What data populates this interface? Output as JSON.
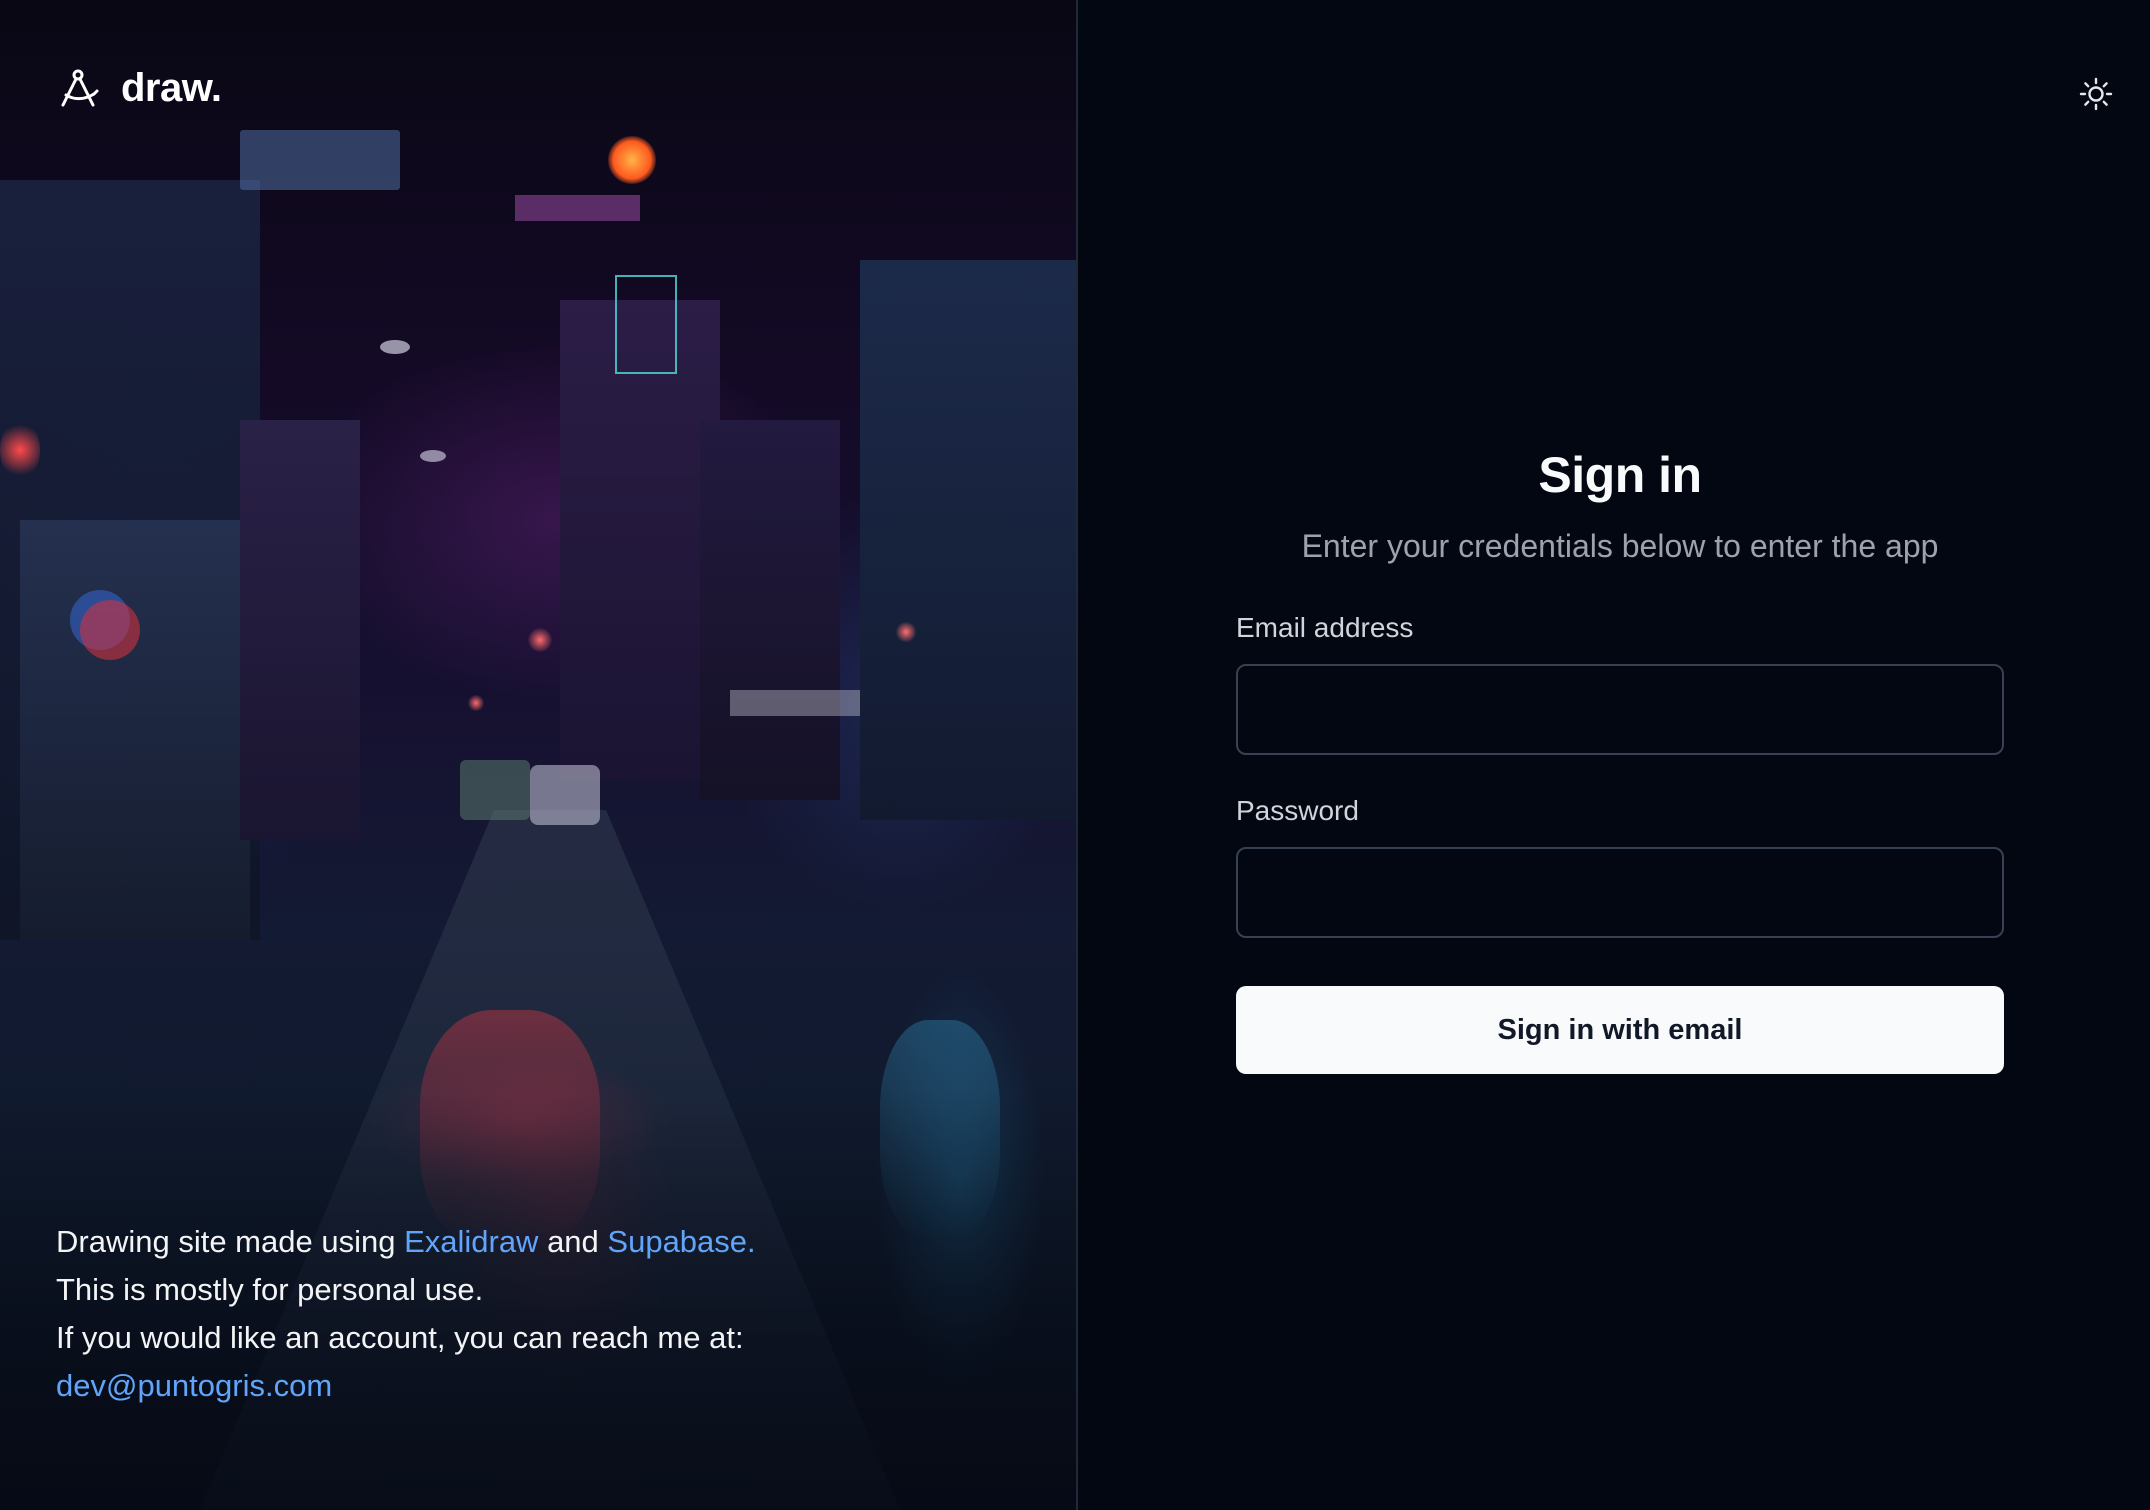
{
  "brand": {
    "logo_icon": "compass-drafting-icon",
    "name": "draw."
  },
  "theme_toggle": {
    "icon": "sun-icon"
  },
  "hero": {
    "line1_prefix": "Drawing site made using ",
    "link_exalidraw": "Exalidraw",
    "line1_middle": " and ",
    "link_supabase": "Supabase.",
    "line2": "This is mostly for personal use.",
    "line3": "If you would like an account, you can reach me at:",
    "email_link": "dev@puntogris.com"
  },
  "form": {
    "title": "Sign in",
    "subtitle": "Enter your credentials below to enter the app",
    "email_label": "Email address",
    "email_value": "",
    "password_label": "Password",
    "password_value": "",
    "submit_label": "Sign in with email"
  },
  "colors": {
    "background": "#030712",
    "link": "#60a5fa",
    "button_bg": "#f9fafb",
    "button_text": "#111827",
    "input_border": "#374151"
  }
}
